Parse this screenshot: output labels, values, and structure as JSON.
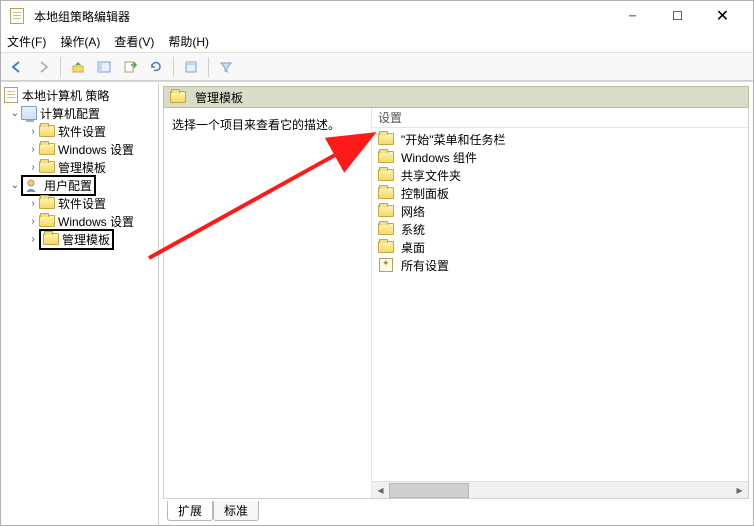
{
  "window": {
    "title": "本地组策略编辑器"
  },
  "menu": {
    "file": "文件(F)",
    "action": "操作(A)",
    "view": "查看(V)",
    "help": "帮助(H)"
  },
  "tree": {
    "root": "本地计算机 策略",
    "computer": "计算机配置",
    "computer_children": {
      "soft": "软件设置",
      "win": "Windows 设置",
      "admin": "管理模板"
    },
    "user": "用户配置",
    "user_children": {
      "soft": "软件设置",
      "win": "Windows 设置",
      "admin": "管理模板"
    }
  },
  "pane": {
    "header": "管理模板",
    "desc_prompt": "选择一个项目来查看它的描述。",
    "col_setting": "设置",
    "items": {
      "start": "\"开始\"菜单和任务栏",
      "wincomp": "Windows 组件",
      "shared": "共享文件夹",
      "control": "控制面板",
      "network": "网络",
      "system": "系统",
      "desktop": "桌面",
      "all": "所有设置"
    }
  },
  "tabs": {
    "ext": "扩展",
    "std": "标准"
  }
}
